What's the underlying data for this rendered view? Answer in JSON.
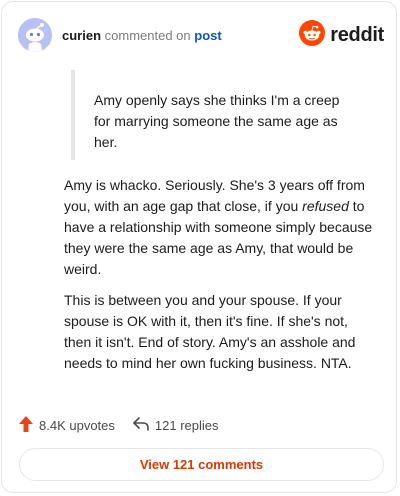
{
  "header": {
    "username": "curien",
    "action_text": "commented on",
    "post_link": "post",
    "brand": "reddit"
  },
  "quote": {
    "text": "Amy openly says she thinks I'm a creep for marrying someone the same age as her."
  },
  "comment": {
    "p1_before": "Amy is whacko. Seriously. She's 3 years off from you, with an age gap that close, if you ",
    "p1_emphasis": "refused",
    "p1_after": " to have a relationship with someone simply because they were the same age as Amy, that would be weird.",
    "p2": "This is between you and your spouse. If your spouse is OK with it, then it's fine. If she's not, then it isn't. End of story. Amy's an asshole and needs to mind her own fucking business. NTA."
  },
  "stats": {
    "upvotes": "8.4K upvotes",
    "replies": "121 replies"
  },
  "actions": {
    "view_comments": "View 121 comments"
  },
  "colors": {
    "reddit_orange": "#ff4500",
    "link_blue": "#0b56c6",
    "upvote_red": "#e8431b",
    "view_button_text": "#d93a00",
    "avatar_bg": "#b9c1f2"
  },
  "icons": {
    "avatar": "snoo-avatar-icon",
    "logo": "reddit-logo-icon",
    "upvote": "upvote-arrow-icon",
    "reply": "reply-arrow-icon"
  }
}
